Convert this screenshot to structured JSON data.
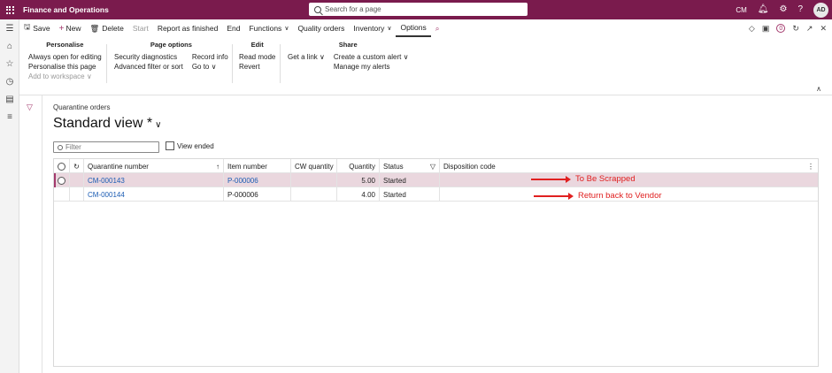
{
  "topbar": {
    "app_title": "Finance and Operations",
    "search_placeholder": "Search for a page",
    "company": "CM",
    "user_initials": "AD"
  },
  "actions": {
    "save": "Save",
    "new": "New",
    "delete": "Delete",
    "start": "Start",
    "report_finished": "Report as finished",
    "end": "End",
    "functions": "Functions",
    "quality_orders": "Quality orders",
    "inventory": "Inventory",
    "options": "Options",
    "notification_count": "0"
  },
  "ribbon": {
    "personalise": {
      "title": "Personalise",
      "items": [
        "Always open for editing",
        "Personalise this page",
        "Add to workspace"
      ]
    },
    "page_options": {
      "title": "Page options",
      "col1": [
        "Security diagnostics",
        "Advanced filter or sort"
      ],
      "col2": [
        "Record info",
        "Go to"
      ]
    },
    "edit": {
      "title": "Edit",
      "items": [
        "Read mode",
        "Revert"
      ]
    },
    "share": {
      "title": "Share",
      "col1": [
        "Get a link"
      ],
      "col2": [
        "Create a custom alert",
        "Manage my alerts"
      ]
    }
  },
  "page": {
    "breadcrumb": "Quarantine orders",
    "view_title": "Standard view *",
    "filter_placeholder": "Filter",
    "view_ended_label": "View ended"
  },
  "grid": {
    "columns": [
      "Quarantine number",
      "Item number",
      "CW quantity",
      "Quantity",
      "Status",
      "Disposition code"
    ],
    "rows": [
      {
        "quarantine_number": "CM-000143",
        "item_number": "P-000006",
        "cw_quantity": "",
        "quantity": "5.00",
        "status": "Started",
        "disposition_code": ""
      },
      {
        "quarantine_number": "CM-000144",
        "item_number": "P-000006",
        "cw_quantity": "",
        "quantity": "4.00",
        "status": "Started",
        "disposition_code": ""
      }
    ]
  },
  "annotations": {
    "row1": "To Be Scrapped",
    "row2": "Return back to Vendor"
  },
  "colors": {
    "brand": "#7a1b4d",
    "selected_row": "#ead7de",
    "link": "#1b5cb3",
    "annotation": "#e02020"
  }
}
